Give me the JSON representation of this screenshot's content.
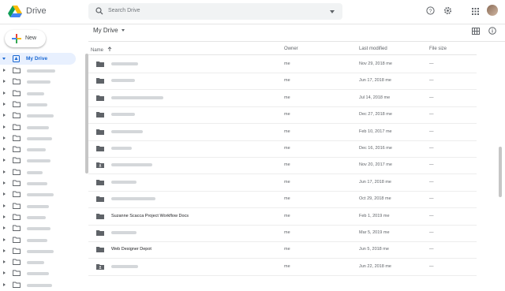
{
  "app": {
    "title": "Drive"
  },
  "search": {
    "placeholder": "Search Drive"
  },
  "new_button": {
    "label": "New"
  },
  "sidebar": {
    "active_item": {
      "label": "My Drive"
    },
    "items": [
      {
        "blur_width": 36
      },
      {
        "blur_width": 30
      },
      {
        "blur_width": 22
      },
      {
        "blur_width": 26
      },
      {
        "blur_width": 34
      },
      {
        "blur_width": 28
      },
      {
        "blur_width": 32
      },
      {
        "blur_width": 24
      },
      {
        "blur_width": 30
      },
      {
        "blur_width": 20
      },
      {
        "blur_width": 26
      },
      {
        "blur_width": 34
      },
      {
        "blur_width": 28
      },
      {
        "blur_width": 24
      },
      {
        "blur_width": 30
      },
      {
        "blur_width": 26
      },
      {
        "blur_width": 34
      },
      {
        "blur_width": 22
      },
      {
        "blur_width": 28
      },
      {
        "blur_width": 32
      }
    ]
  },
  "breadcrumb": {
    "label": "My Drive"
  },
  "columns": {
    "name": "Name",
    "owner": "Owner",
    "modified": "Last modified",
    "size": "File size"
  },
  "files": [
    {
      "name": "",
      "blurred": true,
      "icon": "folder",
      "owner": "me",
      "modified": "Nov 29, 2018 me",
      "size": "—"
    },
    {
      "name": "",
      "blurred": true,
      "icon": "folder",
      "owner": "me",
      "modified": "Jun 17, 2018 me",
      "size": "—"
    },
    {
      "name": "",
      "blurred": true,
      "icon": "folder",
      "owner": "me",
      "modified": "Jul 14, 2018 me",
      "size": "—"
    },
    {
      "name": "",
      "blurred": true,
      "icon": "folder",
      "owner": "me",
      "modified": "Dec 27, 2018 me",
      "size": "—"
    },
    {
      "name": "",
      "blurred": true,
      "icon": "folder",
      "owner": "me",
      "modified": "Feb 10, 2017 me",
      "size": "—"
    },
    {
      "name": "",
      "blurred": true,
      "icon": "folder",
      "owner": "me",
      "modified": "Dec 16, 2016 me",
      "size": "—"
    },
    {
      "name": "",
      "blurred": true,
      "icon": "shared-folder",
      "owner": "me",
      "modified": "Nov 20, 2017 me",
      "size": "—"
    },
    {
      "name": "",
      "blurred": true,
      "icon": "folder",
      "owner": "me",
      "modified": "Jun 17, 2018 me",
      "size": "—"
    },
    {
      "name": "",
      "blurred": true,
      "icon": "folder",
      "owner": "me",
      "modified": "Oct 29, 2018 me",
      "size": "—"
    },
    {
      "name": "Suzanne Scacca Project Workflow Docs",
      "blurred": false,
      "icon": "folder",
      "owner": "me",
      "modified": "Feb 1, 2019 me",
      "size": "—"
    },
    {
      "name": "",
      "blurred": true,
      "icon": "folder",
      "owner": "me",
      "modified": "Mar 5, 2019 me",
      "size": "—"
    },
    {
      "name": "Web Designer Depot",
      "blurred": false,
      "icon": "folder",
      "owner": "me",
      "modified": "Jun 5, 2018 me",
      "size": "—"
    },
    {
      "name": "",
      "blurred": true,
      "icon": "shared-folder",
      "owner": "me",
      "modified": "Jun 22, 2018 me",
      "size": "—"
    }
  ],
  "icons": {
    "logo": "drive-logo-icon",
    "search": "search-icon",
    "help": "help-icon",
    "settings": "gear-icon",
    "apps": "apps-grid-icon",
    "grid_view": "grid-view-icon",
    "info": "info-icon"
  },
  "colors": {
    "accent": "#1967d2",
    "active_bg": "#e8f0fe",
    "folder": "#5f6368"
  }
}
